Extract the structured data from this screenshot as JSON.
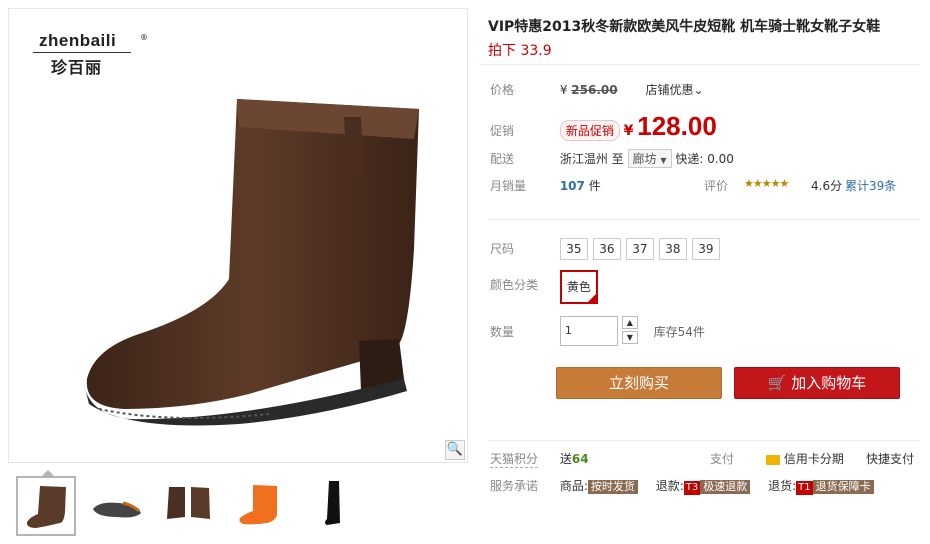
{
  "brand": {
    "name": "zhenbaili",
    "reg": "®",
    "name_cn": "珍百丽"
  },
  "product": {
    "title": "VIP特惠2013秋冬新款欧美风牛皮短靴 机车骑士靴女靴子女鞋",
    "subtitle": "拍下 33.9"
  },
  "price": {
    "label": "价格",
    "yen": "¥",
    "original": "256.00",
    "shop_discount": "店铺优惠",
    "promo_label": "促销",
    "promo_tag": "新品促销",
    "promo_yen": "¥",
    "promo_price": "128.00"
  },
  "shipping": {
    "label": "配送",
    "from": "浙江温州",
    "to_word": "至",
    "dest": "廊坊",
    "express_label": "快递:",
    "express_fee": "0.00"
  },
  "sales": {
    "label": "月销量",
    "count": "107",
    "unit": "件",
    "rating_label": "评价",
    "stars": "★★★★★",
    "score": "4.6分",
    "total": "累计39条"
  },
  "options": {
    "size_label": "尺码",
    "sizes": [
      "35",
      "36",
      "37",
      "38",
      "39"
    ],
    "color_label": "颜色分类",
    "color": "黄色",
    "qty_label": "数量",
    "qty": "1",
    "stock": "库存54件"
  },
  "buttons": {
    "buy": "立刻购买",
    "cart": "加入购物车"
  },
  "footer": {
    "points_label": "天猫积分",
    "points_prefix": "送",
    "points": "64",
    "pay_label": "支付",
    "credit": "信用卡分期",
    "quick_pay": "快捷支付",
    "service_label": "服务承诺",
    "goods_label": "商品:",
    "goods_badge": "按时发货",
    "return_label": "退款:",
    "return_t": "T3",
    "return_badge": "极速退款",
    "refund_label": "退货:",
    "refund_t": "T1",
    "refund_badge": "退货保障卡"
  },
  "icons": {
    "zoom": "magnifier-icon",
    "cart": "cart-icon",
    "card": "credit-card-icon"
  },
  "colors": {
    "accent_red": "#c40000",
    "buy_brown": "#c77b39",
    "link_blue": "#2d6ea9"
  }
}
